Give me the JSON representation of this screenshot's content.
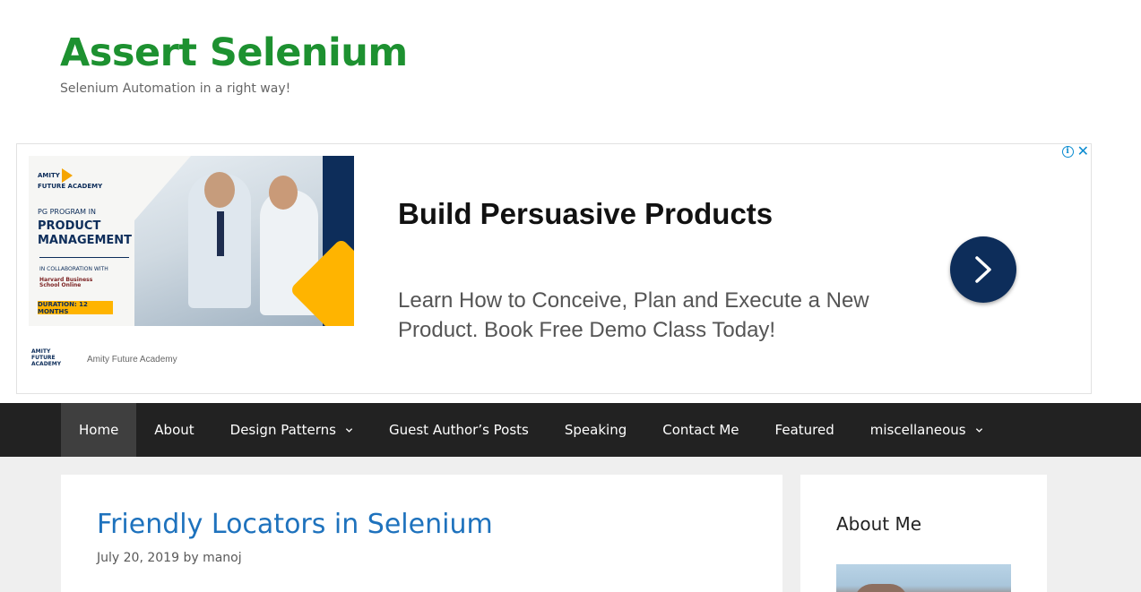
{
  "header": {
    "site_title": "Assert Selenium",
    "tagline": "Selenium Automation in a right way!"
  },
  "ad": {
    "info_icon": "info-icon",
    "close_icon": "close-icon",
    "image": {
      "logo_line1": "AMITY",
      "logo_line2": "FUTURE ACADEMY",
      "program_line": "PG PROGRAM IN",
      "product_line1": "PRODUCT",
      "product_line2": "MANAGEMENT",
      "collab_line": "IN COLLABORATION WITH",
      "hbs_line1": "Harvard Business",
      "hbs_line2": "School Online",
      "duration": "DURATION: 12 MONTHS"
    },
    "brand_logo_line1": "AMITY",
    "brand_logo_line2": "FUTURE ACADEMY",
    "brand_name": "Amity Future Academy",
    "headline": "Build Persuasive Products",
    "description": "Learn How to Conceive, Plan and Execute a New Product. Book Free Demo Class Today!",
    "arrow_icon": "chevron-right-icon"
  },
  "nav": {
    "items": [
      {
        "label": "Home",
        "active": true
      },
      {
        "label": "About"
      },
      {
        "label": "Design Patterns",
        "dropdown": true
      },
      {
        "label": "Guest Author’s Posts"
      },
      {
        "label": "Speaking"
      },
      {
        "label": "Contact Me"
      },
      {
        "label": "Featured"
      },
      {
        "label": "miscellaneous",
        "dropdown": true
      }
    ]
  },
  "post": {
    "title": "Friendly Locators in Selenium",
    "date": "July 20, 2019",
    "by": "by",
    "author": "manoj"
  },
  "sidebar": {
    "widget_title": "About Me"
  },
  "colors": {
    "site_title": "#1d9130",
    "nav_bg": "#222222",
    "nav_active": "#3f3f3f",
    "link": "#1e72bd",
    "ad_navy": "#0d2d5a",
    "ad_yellow": "#ffb400"
  }
}
